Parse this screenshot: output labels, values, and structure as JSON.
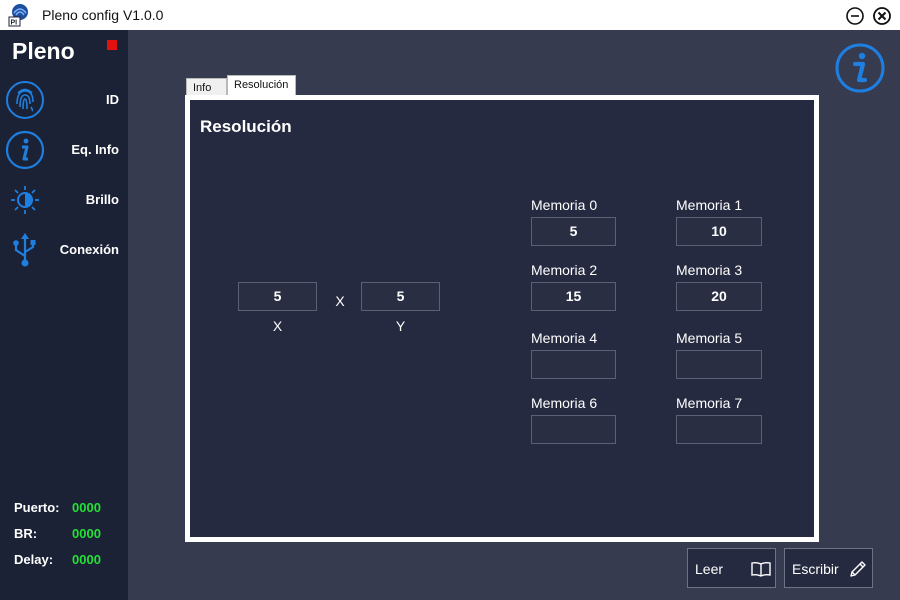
{
  "window": {
    "title": "Pleno config V1.0.0",
    "logo_text": "PI"
  },
  "sidebar": {
    "brand": "Pleno",
    "status_color": "#e31010",
    "items": [
      {
        "label": "ID",
        "icon": "fingerprint-icon"
      },
      {
        "label": "Eq. Info",
        "icon": "info-icon"
      },
      {
        "label": "Brillo",
        "icon": "brightness-icon"
      },
      {
        "label": "Conexión",
        "icon": "usb-icon"
      }
    ],
    "stats": [
      {
        "label": "Puerto:",
        "value": "0000"
      },
      {
        "label": "BR:",
        "value": "0000"
      },
      {
        "label": "Delay:",
        "value": "0000"
      }
    ]
  },
  "tabs": [
    {
      "label": "Info",
      "active": false
    },
    {
      "label": "Resolución",
      "active": true
    }
  ],
  "panel": {
    "title": "Resolución",
    "resolution": {
      "x_value": "5",
      "separator": "X",
      "y_value": "5",
      "x_caption": "X",
      "y_caption": "Y"
    },
    "memories": [
      {
        "label": "Memoria 0",
        "value": "5"
      },
      {
        "label": "Memoria 1",
        "value": "10"
      },
      {
        "label": "Memoria 2",
        "value": "15"
      },
      {
        "label": "Memoria 3",
        "value": "20"
      },
      {
        "label": "Memoria 4",
        "value": ""
      },
      {
        "label": "Memoria 5",
        "value": ""
      },
      {
        "label": "Memoria 6",
        "value": ""
      },
      {
        "label": "Memoria 7",
        "value": ""
      }
    ]
  },
  "actions": {
    "read_label": "Leer",
    "read_icon": "book-icon",
    "write_label": "Escribir",
    "write_icon": "pencil-icon"
  },
  "colors": {
    "accent": "#1e7fe0",
    "sidebar_bg": "#1c2235",
    "main_bg": "#363b50",
    "panel_bg": "#262a40",
    "stat_value": "#22e035"
  }
}
